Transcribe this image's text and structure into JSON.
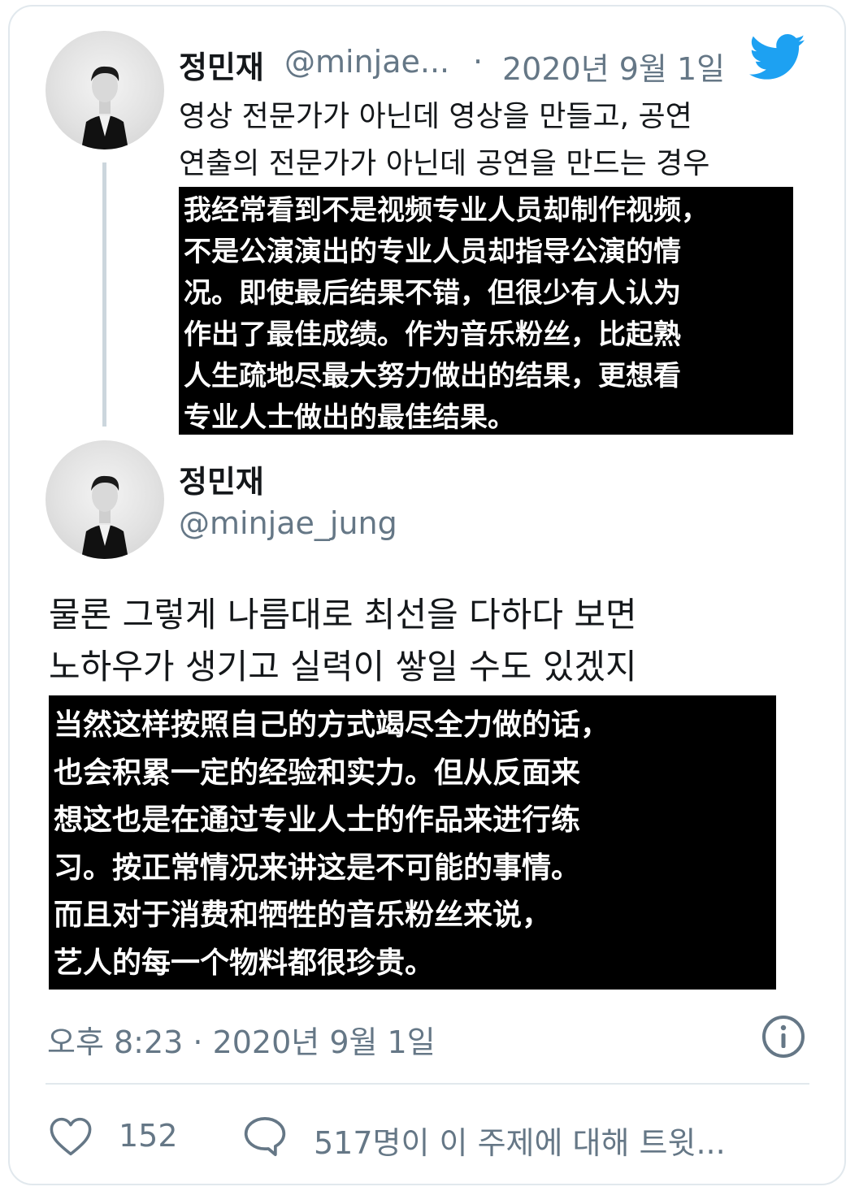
{
  "colors": {
    "twitter_blue": "#1da1f2",
    "secondary_text": "#657786",
    "primary_text": "#14171a",
    "divider": "#e1e8ed",
    "overlay_bg": "#000000"
  },
  "icons": {
    "brand": "twitter-bird-icon",
    "info": "info-icon",
    "like": "heart-icon",
    "reply": "speech-bubble-icon"
  },
  "parent_tweet": {
    "name": "정민재",
    "handle": "@minjae...",
    "separator": "·",
    "date": "2020년 9월 1일",
    "text_lines": [
      "영상 전문가가 아닌데 영상을 만들고, 공연",
      "연출의 전문가가 아닌데 공연을 만드는 경우"
    ],
    "translation_lines": [
      "我经常看到不是视频专业人员却制作视频，",
      "不是公演演出的专业人员却指导公演的情",
      "况。即使最后结果不错，但很少有人认为",
      "作出了最佳成绩。作为音乐粉丝，比起熟",
      "人生疏地尽最大努力做出的结果，更想看",
      "专业人士做出的最佳结果。"
    ]
  },
  "main_tweet": {
    "name": "정민재",
    "handle": "@minjae_jung",
    "text_lines": [
      "물론 그렇게 나름대로 최선을 다하다 보면",
      "노하우가 생기고 실력이 쌓일 수도 있겠지"
    ],
    "translation_lines": [
      "当然这样按照自己的方式竭尽全力做的话，",
      "也会积累一定的经验和实力。但从反面来",
      "想这也是在通过专业人士的作品来进行练",
      "习。按正常情况来讲这是不可能的事情。",
      "而且对于消费和牺牲的音乐粉丝来说，",
      "艺人的每一个物料都很珍贵。"
    ],
    "timestamp": "오후 8:23 · 2020년 9월 1일"
  },
  "footer": {
    "likes": "152",
    "discussion": "517명이 이 주제에 대해 트윗..."
  }
}
